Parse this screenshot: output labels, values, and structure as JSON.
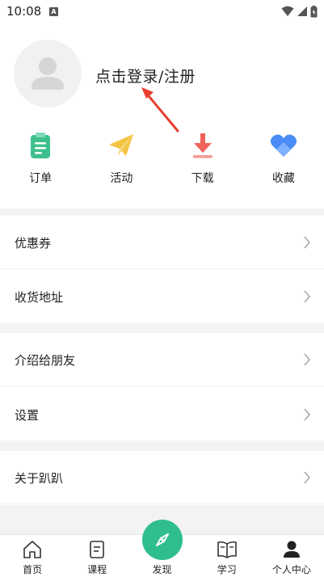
{
  "status_bar": {
    "time": "10:08",
    "indicator": "A",
    "icons": [
      "wifi-icon",
      "signal-icon",
      "battery-icon"
    ]
  },
  "profile": {
    "login_text": "点击登录/注册",
    "avatar_icon": "user-avatar-icon"
  },
  "quick_actions": [
    {
      "label": "订单",
      "icon": "order-clipboard-icon",
      "color": "#3ec08c"
    },
    {
      "label": "活动",
      "icon": "paper-plane-icon",
      "color": "#f5c443"
    },
    {
      "label": "下载",
      "icon": "download-icon",
      "color": "#f0625a"
    },
    {
      "label": "收藏",
      "icon": "heart-icon",
      "color": "#4a8cf5"
    }
  ],
  "menu": {
    "coupons": "优惠券",
    "address": "收货地址",
    "invite": "介绍给朋友",
    "settings": "设置",
    "about": "关于趴趴"
  },
  "tabbar": [
    {
      "label": "首页",
      "icon": "home-icon"
    },
    {
      "label": "课程",
      "icon": "course-icon"
    },
    {
      "label": "发现",
      "icon": "compass-icon",
      "color": "#2fbe8c"
    },
    {
      "label": "学习",
      "icon": "book-icon"
    },
    {
      "label": "个人中心",
      "icon": "person-icon"
    }
  ]
}
